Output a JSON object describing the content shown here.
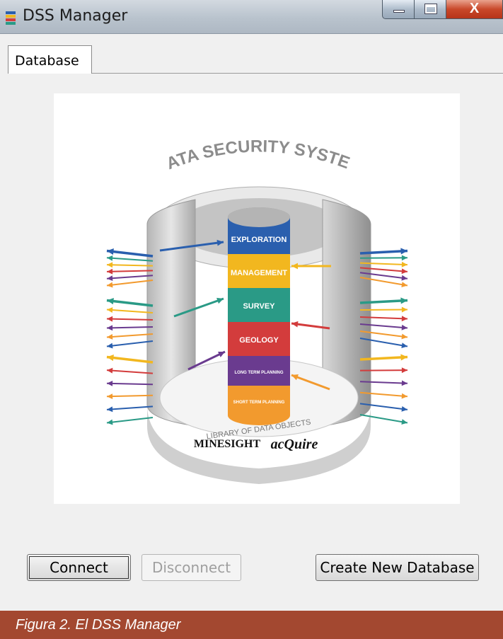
{
  "window": {
    "title": "DSS Manager",
    "close_glyph": "X"
  },
  "tabs": [
    {
      "label": "Database",
      "active": true
    }
  ],
  "diagram": {
    "heading": "DATA SECURITY SYSTEM",
    "layers": [
      "EXPLORATION",
      "MANAGEMENT",
      "SURVEY",
      "GEOLOGY",
      "LONG TERM PLANNING",
      "SHORT TERM PLANNING"
    ],
    "library_label": "LIBRARY OF DATA OBJECTS",
    "logos": [
      "MINESIGHT",
      "acQuire"
    ]
  },
  "buttons": {
    "connect": "Connect",
    "disconnect": "Disconnect",
    "create": "Create New Database"
  },
  "figure_caption": "Figura 2. El DSS Manager",
  "colors": {
    "caption_bar": "#a34830",
    "exploration": "#2a5fae",
    "management": "#f2b71f",
    "survey": "#2a9a86",
    "geology": "#d33c3c",
    "long_term": "#6a3b8f",
    "short_term": "#f29a2e"
  }
}
